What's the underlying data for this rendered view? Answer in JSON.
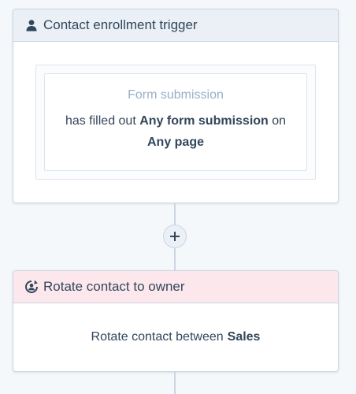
{
  "trigger": {
    "header_label": "Contact enrollment trigger",
    "icon": "contact-person-icon",
    "filter": {
      "title": "Form submission",
      "line1_prefix": "has filled out",
      "line1_value": "Any form submission",
      "line1_suffix": "on",
      "line2_value": "Any page"
    }
  },
  "add_action": {
    "icon": "plus-icon"
  },
  "action": {
    "header_label": "Rotate contact to owner",
    "icon": "rotate-owner-icon",
    "body_prefix": "Rotate contact between",
    "body_value": "Sales"
  },
  "colors": {
    "trigger_header_bg": "#eaf0f6",
    "action_header_bg": "#fce8ec",
    "border": "#cbd6e2",
    "text": "#33475b",
    "muted_text": "#99afc4"
  }
}
